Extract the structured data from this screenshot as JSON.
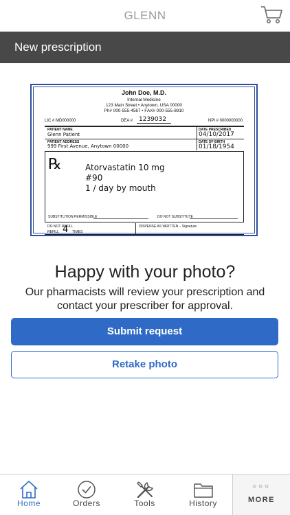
{
  "header": {
    "title": "GLENN",
    "cart_icon": "cart-icon"
  },
  "subheader": {
    "title": "New prescription"
  },
  "prescription": {
    "doctor": "John Doe, M.D.",
    "specialty": "Internal Medicine",
    "address": "123 Main Street  •  Anytown, USA 00000",
    "phone_fax": "Ph# 000-555-4567 • FAX# 000-555-8910",
    "lic": "LIC # MD000000",
    "dea_label": "DEA #",
    "dea": "1239032",
    "npi": "NPI #  0000000000",
    "patient_name_label": "PATIENT NAME",
    "patient_name": "Glenn Patient",
    "date_prescribed_label": "DATE PRESCRIBED",
    "date_prescribed": "04/10/2017",
    "patient_address_label": "PATIENT ADDRESS",
    "patient_address": "999 First Avenue, Anytown 00000",
    "dob_label": "DATE OF BIRTH",
    "dob": "01/18/1954",
    "rx_symbol": "℞",
    "drug": "Atorvastatin 10 mg",
    "quantity": "#90",
    "directions": "1 / day by mouth",
    "substitution_permissible": "SUBSTITUTION PERMISSIBLE",
    "do_not_substitute": "DO NOT SUBSTITUTE",
    "do_not_refill": "DO NOT REFILL",
    "refill_label": "REFILL",
    "refill_count": "4",
    "refill_times": "TIMES",
    "dispense_as_written": "DISPENSE AS WRITTEN – Signature"
  },
  "confirm": {
    "question": "Happy with your photo?",
    "description_line1": "Our pharmacists will review your prescription and",
    "description_line2": "contact your prescriber for approval."
  },
  "buttons": {
    "submit": "Submit request",
    "retake": "Retake photo"
  },
  "tabbar": {
    "accent": "#2f6bc6",
    "tabs": [
      {
        "label": "Home",
        "icon": "home-icon",
        "active": true
      },
      {
        "label": "Orders",
        "icon": "check-circle-icon",
        "active": false
      },
      {
        "label": "Tools",
        "icon": "tools-icon",
        "active": false
      },
      {
        "label": "History",
        "icon": "folder-icon",
        "active": false
      }
    ],
    "more": {
      "label": "MORE",
      "dots": "○○○"
    }
  }
}
